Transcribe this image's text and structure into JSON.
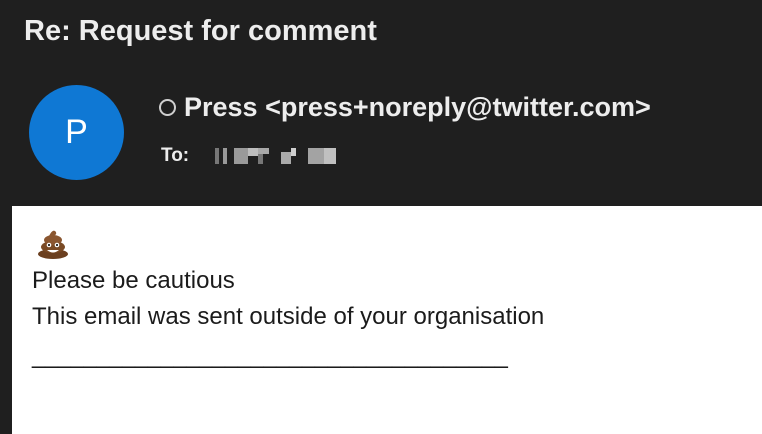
{
  "email": {
    "subject": "Re: Request for comment",
    "avatar_letter": "P",
    "sender": "Press <press+noreply@twitter.com>",
    "to_label": "To:",
    "recipient_redacted": true
  },
  "body": {
    "icon": "pile-of-poo-emoji-icon",
    "warning_title": "Please be cautious",
    "warning_text": "This email was sent outside of your organisation",
    "separator": "_____________________________________"
  },
  "colors": {
    "header_bg": "#1f1f1f",
    "avatar_bg": "#0f78d4",
    "body_bg": "#ffffff",
    "header_text": "#ededed"
  }
}
